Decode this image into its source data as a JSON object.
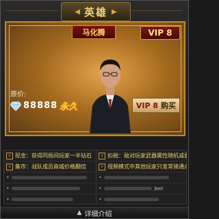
{
  "header": {
    "title": "英雄"
  },
  "hero": {
    "name": "马化腾",
    "vip_tag": "VIP 8",
    "price_label": "原价:",
    "price_value": "88888",
    "duration": "永久",
    "buy_vip": "VIP 8",
    "buy_label": "购买"
  },
  "info": {
    "items": [
      {
        "key": "v",
        "text": "现金：获得同局间玩家一半钻石"
      },
      {
        "key": "v",
        "text": "扣税：敌对玩家武器属性随机减弱"
      },
      {
        "key": "v",
        "text": "集市：战队成员商城价格翻倍"
      },
      {
        "key": "v",
        "text": "视频模式中其他玩家只准常骑通点"
      }
    ],
    "extra_right_text": "3ml"
  },
  "footer": {
    "label": "详细介绍"
  },
  "colors": {
    "accent": "#c28a2e",
    "vip_red": "#7a1818",
    "gold_text": "#f0d06a"
  }
}
